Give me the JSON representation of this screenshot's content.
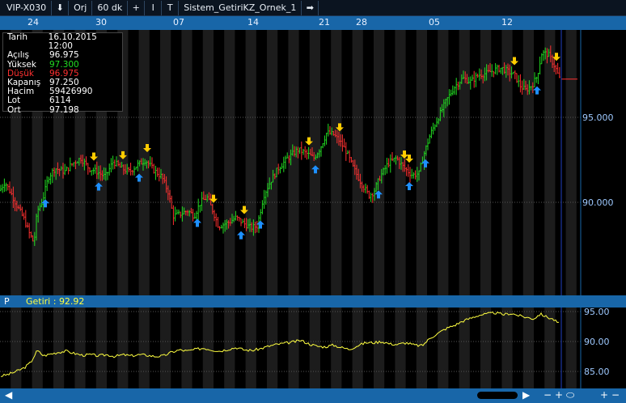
{
  "toolbar": {
    "symbol": "VIP-X030",
    "mode": "Orj",
    "period": "60 dk",
    "plus": "+",
    "bar_icon": "I",
    "draw_icon": "T",
    "system": "Sistem_GetiriKZ_Ornek_1",
    "arrow_icon": "⬇",
    "next_icon": "➡"
  },
  "date_axis": [
    "24",
    "30",
    "07",
    "14",
    "21",
    "28",
    "05",
    "12"
  ],
  "info_panel": {
    "rows": [
      {
        "label": "Tarih",
        "value": "16.10.2015 12:00",
        "color": "#ffffff"
      },
      {
        "label": "Açılış",
        "value": "96.975",
        "color": "#ffffff"
      },
      {
        "label": "Yüksek",
        "value": "97.300",
        "color": "#22dd22"
      },
      {
        "label": "Düşük",
        "value": "96.975",
        "color": "#ff3030"
      },
      {
        "label": "Kapanış",
        "value": "97.250",
        "color": "#ffffff"
      },
      {
        "label": "Hacim",
        "value": "59426990",
        "color": "#ffffff"
      },
      {
        "label": "Lot",
        "value": "6114",
        "color": "#ffffff"
      },
      {
        "label": "Ort",
        "value": "97.198",
        "color": "#ffffff"
      }
    ]
  },
  "price_axis": {
    "ticks": [
      "95.000",
      "90.000"
    ]
  },
  "panel_header": {
    "letter": "P",
    "title": "Getiri : 92.92"
  },
  "return_axis": {
    "ticks": [
      "95.00",
      "90.00",
      "85.00"
    ]
  },
  "bottom_bar": {
    "left": "◀",
    "right": "▶",
    "minus": "−",
    "plus": "+",
    "zoom": "⬭",
    "plus2": "+",
    "minus2": "−"
  },
  "colors": {
    "up": "#22dd22",
    "down": "#ff3030",
    "buy": "#1e90ff",
    "sell": "#ffcc00",
    "line": "#ffff40",
    "accent": "#1866a8"
  },
  "chart_data": [
    {
      "type": "candlestick",
      "title": "VIP-X030 60 dk",
      "x_ticks": [
        "24",
        "30",
        "07",
        "14",
        "21",
        "28",
        "05",
        "12"
      ],
      "y_ticks": [
        95.0,
        90.0
      ],
      "ylim": [
        85.0,
        100.0
      ],
      "close_anchors": [
        [
          0,
          90.7
        ],
        [
          6,
          91.2
        ],
        [
          14,
          90.5
        ],
        [
          22,
          89.7
        ],
        [
          30,
          89.0
        ],
        [
          36,
          88.2
        ],
        [
          42,
          87.6
        ],
        [
          46,
          89.5
        ],
        [
          52,
          90.0
        ],
        [
          60,
          91.5
        ],
        [
          68,
          92.0
        ],
        [
          80,
          91.8
        ],
        [
          90,
          92.3
        ],
        [
          100,
          92.6
        ],
        [
          110,
          92.0
        ],
        [
          120,
          91.8
        ],
        [
          130,
          91.5
        ],
        [
          140,
          92.4
        ],
        [
          150,
          92.0
        ],
        [
          160,
          91.8
        ],
        [
          170,
          92.2
        ],
        [
          180,
          92.5
        ],
        [
          190,
          91.9
        ],
        [
          200,
          91.5
        ],
        [
          208,
          90.6
        ],
        [
          214,
          89.2
        ],
        [
          222,
          89.3
        ],
        [
          232,
          89.5
        ],
        [
          240,
          89.2
        ],
        [
          248,
          90.0
        ],
        [
          256,
          90.3
        ],
        [
          264,
          89.4
        ],
        [
          270,
          88.6
        ],
        [
          282,
          88.8
        ],
        [
          292,
          89.1
        ],
        [
          300,
          88.8
        ],
        [
          310,
          88.5
        ],
        [
          318,
          88.6
        ],
        [
          326,
          90.4
        ],
        [
          334,
          91.2
        ],
        [
          344,
          92.0
        ],
        [
          356,
          92.6
        ],
        [
          368,
          93.1
        ],
        [
          378,
          92.9
        ],
        [
          388,
          92.6
        ],
        [
          396,
          93.2
        ],
        [
          404,
          94.1
        ],
        [
          412,
          94.0
        ],
        [
          420,
          93.6
        ],
        [
          428,
          93.0
        ],
        [
          436,
          92.1
        ],
        [
          446,
          91.2
        ],
        [
          456,
          90.4
        ],
        [
          462,
          90.6
        ],
        [
          470,
          91.5
        ],
        [
          480,
          92.3
        ],
        [
          490,
          92.6
        ],
        [
          500,
          92.0
        ],
        [
          510,
          91.6
        ],
        [
          518,
          91.7
        ],
        [
          524,
          92.8
        ],
        [
          532,
          94.0
        ],
        [
          542,
          95.0
        ],
        [
          552,
          96.0
        ],
        [
          562,
          96.8
        ],
        [
          572,
          97.3
        ],
        [
          582,
          97.1
        ],
        [
          592,
          97.5
        ],
        [
          602,
          97.6
        ],
        [
          612,
          97.8
        ],
        [
          620,
          97.9
        ],
        [
          628,
          97.7
        ],
        [
          636,
          97.5
        ],
        [
          644,
          96.8
        ],
        [
          650,
          96.6
        ],
        [
          658,
          96.9
        ],
        [
          664,
          97.4
        ],
        [
          670,
          98.8
        ],
        [
          678,
          98.7
        ],
        [
          686,
          98.0
        ],
        [
          692,
          97.25
        ]
      ],
      "buy_signals": [
        56,
        122,
        172,
        244,
        298,
        322,
        390,
        468,
        506,
        526,
        664
      ],
      "sell_signals": [
        116,
        152,
        182,
        264,
        302,
        382,
        420,
        500,
        506,
        636,
        688
      ],
      "last_close": 97.25
    },
    {
      "type": "line",
      "title": "Getiri : 92.92",
      "series": [
        {
          "name": "Getiri"
        }
      ],
      "y_ticks": [
        95.0,
        90.0,
        85.0
      ],
      "ylim": [
        83.0,
        96.5
      ],
      "points": [
        [
          0,
          84.2
        ],
        [
          10,
          84.5
        ],
        [
          20,
          85.0
        ],
        [
          30,
          85.6
        ],
        [
          38,
          86.5
        ],
        [
          46,
          88.5
        ],
        [
          54,
          87.6
        ],
        [
          62,
          87.9
        ],
        [
          72,
          88.2
        ],
        [
          82,
          88.4
        ],
        [
          92,
          88.0
        ],
        [
          102,
          87.7
        ],
        [
          112,
          87.8
        ],
        [
          122,
          87.6
        ],
        [
          132,
          87.8
        ],
        [
          142,
          87.5
        ],
        [
          152,
          87.8
        ],
        [
          162,
          87.6
        ],
        [
          172,
          87.8
        ],
        [
          182,
          87.7
        ],
        [
          192,
          87.5
        ],
        [
          202,
          87.6
        ],
        [
          212,
          88.2
        ],
        [
          222,
          88.6
        ],
        [
          232,
          88.4
        ],
        [
          242,
          88.7
        ],
        [
          252,
          88.9
        ],
        [
          262,
          88.6
        ],
        [
          272,
          88.4
        ],
        [
          282,
          88.7
        ],
        [
          292,
          89.0
        ],
        [
          302,
          88.6
        ],
        [
          312,
          88.5
        ],
        [
          322,
          88.8
        ],
        [
          332,
          89.2
        ],
        [
          342,
          89.5
        ],
        [
          352,
          89.7
        ],
        [
          362,
          89.9
        ],
        [
          372,
          90.2
        ],
        [
          382,
          89.6
        ],
        [
          392,
          89.2
        ],
        [
          402,
          89.1
        ],
        [
          412,
          89.4
        ],
        [
          422,
          89.0
        ],
        [
          432,
          88.7
        ],
        [
          442,
          89.3
        ],
        [
          452,
          89.8
        ],
        [
          462,
          89.8
        ],
        [
          472,
          90.0
        ],
        [
          482,
          89.6
        ],
        [
          492,
          89.5
        ],
        [
          502,
          89.8
        ],
        [
          512,
          89.4
        ],
        [
          522,
          89.3
        ],
        [
          532,
          90.6
        ],
        [
          542,
          91.4
        ],
        [
          552,
          92.2
        ],
        [
          562,
          92.7
        ],
        [
          572,
          93.4
        ],
        [
          582,
          93.9
        ],
        [
          592,
          94.4
        ],
        [
          602,
          94.6
        ],
        [
          612,
          94.8
        ],
        [
          622,
          94.5
        ],
        [
          632,
          94.7
        ],
        [
          642,
          94.3
        ],
        [
          652,
          94.0
        ],
        [
          660,
          93.8
        ],
        [
          668,
          94.6
        ],
        [
          676,
          94.1
        ],
        [
          684,
          93.7
        ],
        [
          692,
          92.92
        ]
      ]
    }
  ]
}
